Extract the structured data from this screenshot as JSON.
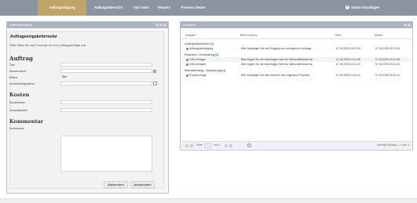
{
  "nav": {
    "items": [
      "Auftragseingang",
      "Auftragsübersicht",
      "Stat Tools",
      "Reports",
      "Process Viewer"
    ],
    "add_label": "Status hinzufügen"
  },
  "left_panel": {
    "title": "Auftragseingang",
    "form_title": "Auftragseingabeformular",
    "form_intro": "Bitte füllen Sie das Formular für eine Auftragsanfrage aus.",
    "section_order": "Auftrag",
    "fields": [
      {
        "label": "Titel",
        "value": ""
      },
      {
        "label": "Kundenname",
        "value": ""
      },
      {
        "label": "Status",
        "value": "Neu"
      },
      {
        "label": "Auslieferungsdatum",
        "value": ""
      }
    ],
    "section_costs": "Kosten",
    "cost_fields": [
      {
        "label": "Einzelkosten",
        "value": ""
      },
      {
        "label": "Gesamtkosten",
        "value": ""
      }
    ],
    "section_comment": "Kommentar",
    "comment_label": "Kommentar",
    "buttons": {
      "cancel": "Abbrechen",
      "submit": "Abschicken"
    }
  },
  "right_panel": {
    "title": "Aufgaben",
    "columns": [
      "Aufgabe",
      "Beschreibung",
      "Start",
      "Ablauf"
    ],
    "groups": [
      {
        "name": "Auftrag annehmen (1)",
        "rows": [
          {
            "task": "Auftragsbestätigung",
            "desc": "Bitte bestätigen Sie den Eingang des vorliegenden Auftrags",
            "start": "07.04.2009 14:07:50",
            "due": "07.04.2009 15:07:50"
          }
        ]
      },
      {
        "name": "Finanzen - Controlling (2)",
        "rows": [
          {
            "task": "CMS erfragen",
            "desc": "Bitte fragen Sie die hinterlegten Wert für Wirtschaftlichkeit an",
            "start": "07.04.2009 14:11:08",
            "due": "07.04.2009 15:11:08"
          },
          {
            "task": "CMS erfragen",
            "desc": "Bitte fragen Sie die hinterlegten Wert für Wirtschaftlichkeit an",
            "start": "07.04.2009 14:11:20",
            "due": "07.04.2009 15:11:20"
          }
        ]
      },
      {
        "name": "Fachabteilung - Anpassung (1)",
        "rows": [
          {
            "task": "Projektvorlage",
            "desc": "Bitte bestätigen Sie das Ansehen des folgenden Projektes",
            "start": "07.04.2009 14:31:11",
            "due": "07.04.2009 15:31:11"
          }
        ]
      }
    ],
    "pager": {
      "page_label": "Seite",
      "page": "1",
      "of": "von 1",
      "display": "Anzeige Eintrag 1 - 4 von 4"
    }
  },
  "colors": {
    "nav": "#8b95a1",
    "nav_active": "#c0a46a",
    "panel_head": "#aab4c0",
    "group_text": "#4a6e9a"
  }
}
